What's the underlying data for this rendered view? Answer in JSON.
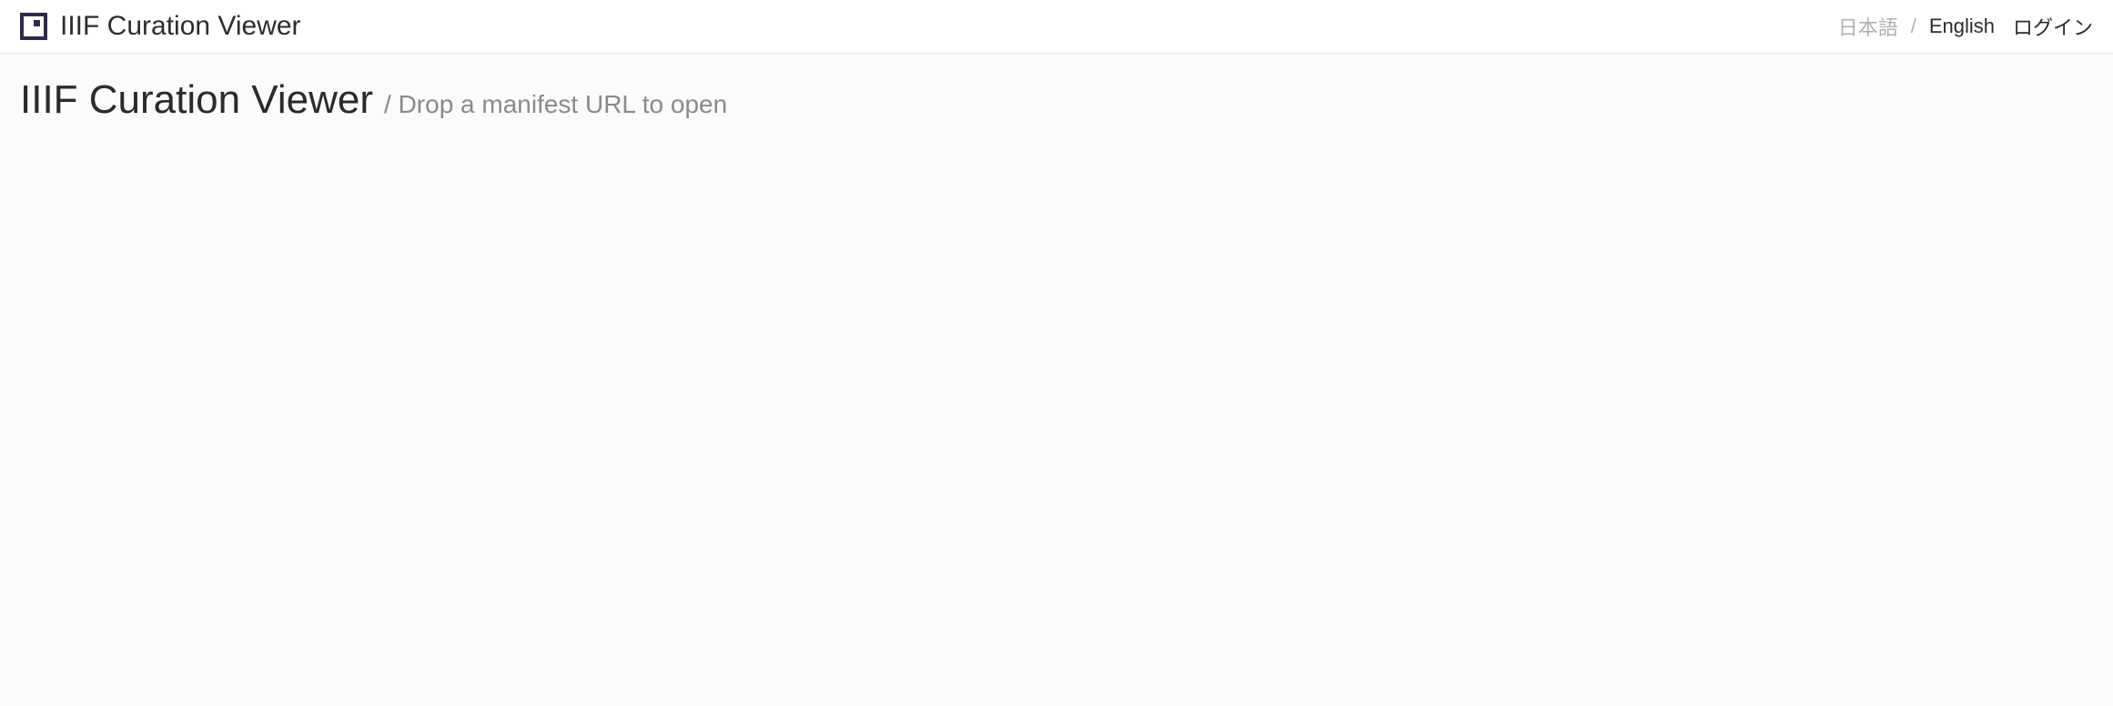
{
  "header": {
    "appTitle": "IIIF Curation Viewer",
    "langJapanese": "日本語",
    "langSeparator": "/",
    "langEnglish": "English",
    "login": "ログイン"
  },
  "main": {
    "pageTitle": "IIIF Curation Viewer",
    "subtitle": "/ Drop a manifest URL to open"
  }
}
